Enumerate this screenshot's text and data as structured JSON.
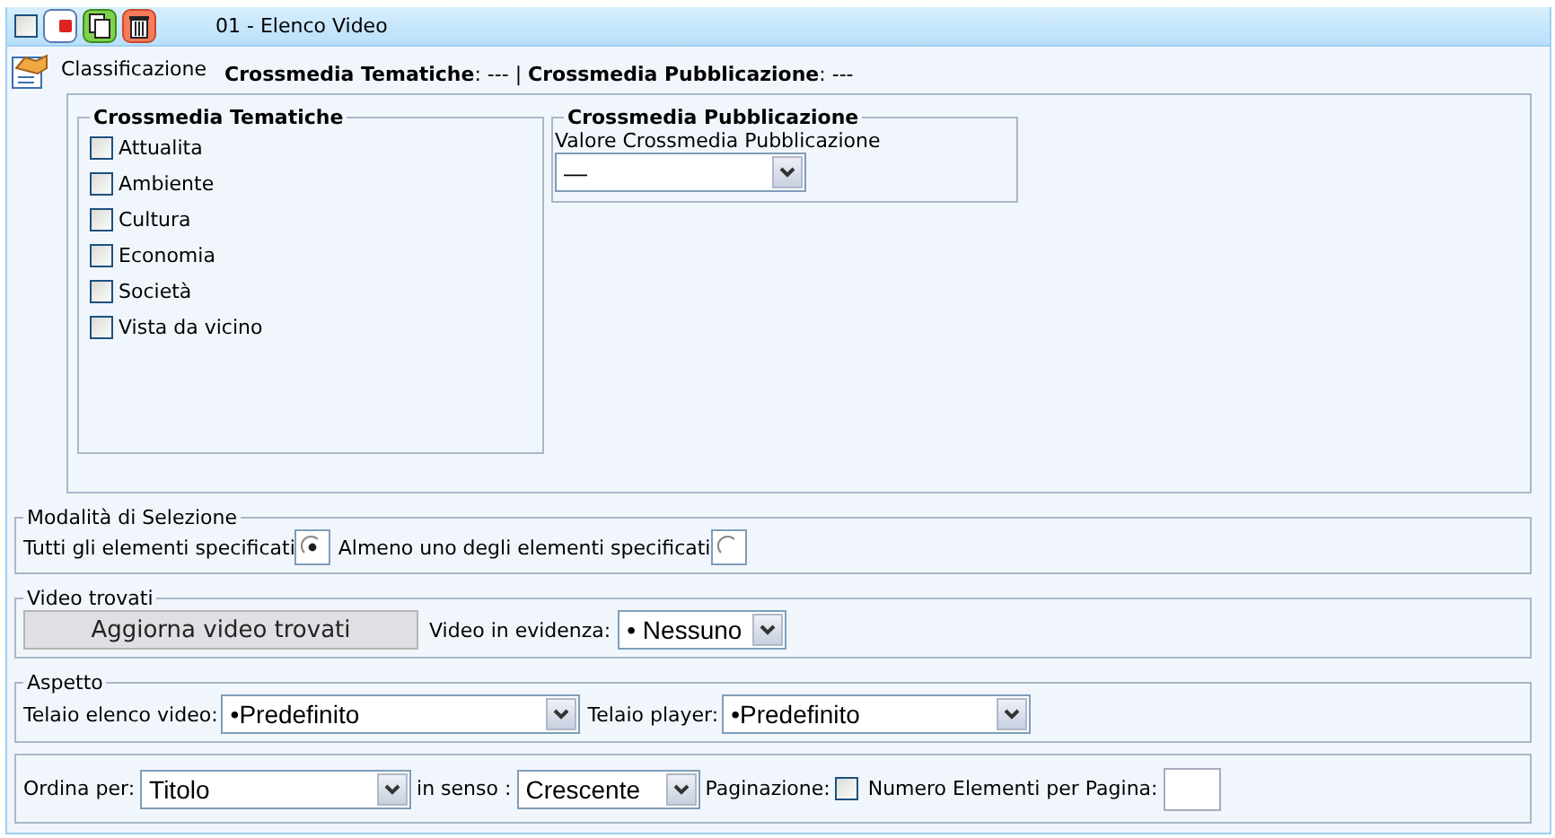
{
  "header": {
    "checked": false,
    "title": "01 - Elenco Video"
  },
  "classification": {
    "label": "Classificazione",
    "summary": "**Crossmedia Tematiche**: --- | **Crossmedia Pubblicazione**: ---",
    "tematiche": {
      "legend": "Crossmedia Tematiche",
      "items": [
        {
          "label": "Attualita",
          "checked": false
        },
        {
          "label": "Ambiente",
          "checked": false
        },
        {
          "label": "Cultura",
          "checked": false
        },
        {
          "label": "Economia",
          "checked": false
        },
        {
          "label": "Società",
          "checked": false
        },
        {
          "label": "Vista da vicino",
          "checked": false
        }
      ]
    },
    "pubblicazione": {
      "legend": "Crossmedia Pubblicazione",
      "field_label": "Valore Crossmedia Pubblicazione",
      "value": "—"
    }
  },
  "selection_mode": {
    "legend": "Modalità di Selezione",
    "options": [
      {
        "label": "Tutti gli elementi specificati",
        "selected": true
      },
      {
        "label": "Almeno uno degli elementi specificati",
        "selected": false
      }
    ]
  },
  "found_videos": {
    "legend": "Video trovati",
    "button": "Aggiorna video trovati",
    "featured_label": "Video in evidenza:",
    "featured_value": "• Nessuno"
  },
  "appearance": {
    "legend": "Aspetto",
    "list_frame_label": "Telaio elenco video:",
    "list_frame_value": "•Predefinito",
    "player_frame_label": "Telaio player:",
    "player_frame_value": "•Predefinito"
  },
  "ordering": {
    "sort_label": "Ordina per:",
    "sort_value": "Titolo",
    "direction_label": "in senso :",
    "direction_value": "Crescente",
    "pagination_label": "Paginazione:",
    "pagination_checked": false,
    "per_page_label": "Numero Elementi per Pagina:"
  }
}
